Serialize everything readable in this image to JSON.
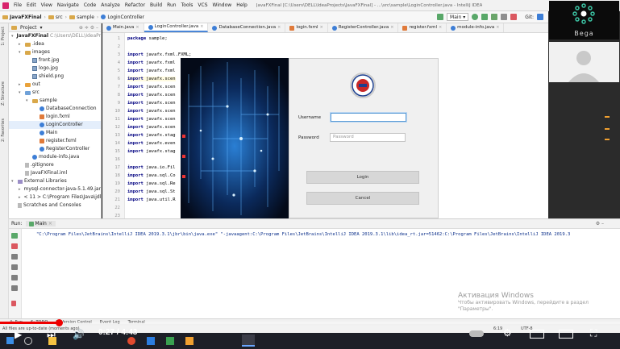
{
  "titlebar": {
    "menu": [
      "File",
      "Edit",
      "View",
      "Navigate",
      "Code",
      "Analyze",
      "Refactor",
      "Build",
      "Run",
      "Tools",
      "VCS",
      "Window",
      "Help"
    ],
    "title": "JavaFXFinal [C:\\Users\\DELL\\IdeaProjects\\JavaFXFinal] - ...\\src\\sample\\LoginController.java - IntelliJ IDEA"
  },
  "navbar": {
    "crumbs": [
      "JavaFXFinal",
      "src",
      "sample",
      "LoginController"
    ],
    "run_config": "Main",
    "git_label": "Git:"
  },
  "left_strip": {
    "top_label": "1: Project",
    "mid_label": "Z: Structure",
    "low_label": "2: Favorites"
  },
  "project": {
    "header": "Project",
    "tree": [
      {
        "label": "JavaFXFinal",
        "extra": "C:\\Users\\DELL\\IdeaProjects\\JavaFXFinal",
        "icon": "folder-blue",
        "depth": 0,
        "arrow": "▾"
      },
      {
        "label": ".idea",
        "icon": "folder",
        "depth": 1,
        "arrow": "▸"
      },
      {
        "label": "images",
        "icon": "folder",
        "depth": 1,
        "arrow": "▾"
      },
      {
        "label": "front.jpg",
        "icon": "image",
        "depth": 2,
        "arrow": ""
      },
      {
        "label": "logo.jpg",
        "icon": "image",
        "depth": 2,
        "arrow": ""
      },
      {
        "label": "shield.png",
        "icon": "image",
        "depth": 2,
        "arrow": ""
      },
      {
        "label": "out",
        "icon": "folder-orange",
        "depth": 1,
        "arrow": "▸"
      },
      {
        "label": "src",
        "icon": "folder-blue",
        "depth": 1,
        "arrow": "▾"
      },
      {
        "label": "sample",
        "icon": "folder",
        "depth": 2,
        "arrow": "▾"
      },
      {
        "label": "DatabaseConnection",
        "icon": "class",
        "depth": 3,
        "arrow": ""
      },
      {
        "label": "login.fxml",
        "icon": "fxml",
        "depth": 3,
        "arrow": ""
      },
      {
        "label": "LoginController",
        "icon": "class",
        "depth": 3,
        "arrow": ""
      },
      {
        "label": "Main",
        "icon": "class",
        "depth": 3,
        "arrow": ""
      },
      {
        "label": "register.fxml",
        "icon": "fxml",
        "depth": 3,
        "arrow": ""
      },
      {
        "label": "RegisterController",
        "icon": "class",
        "depth": 3,
        "arrow": ""
      },
      {
        "label": "module-info.java",
        "icon": "class",
        "depth": 2,
        "arrow": ""
      },
      {
        "label": ".gitignore",
        "icon": "file",
        "depth": 1,
        "arrow": ""
      },
      {
        "label": "JavaFXFinal.iml",
        "icon": "file",
        "depth": 1,
        "arrow": ""
      },
      {
        "label": "External Libraries",
        "icon": "lib",
        "depth": 0,
        "arrow": "▾"
      },
      {
        "label": "mysql-connector-java-5.1.49.jar",
        "icon": "lib",
        "depth": 1,
        "arrow": "▸"
      },
      {
        "label": "< 11 > C:\\Program Files\\Java\\jdk",
        "icon": "lib",
        "depth": 1,
        "arrow": "▸"
      },
      {
        "label": "Scratches and Consoles",
        "icon": "file",
        "depth": 0,
        "arrow": ""
      }
    ]
  },
  "editor": {
    "tabs": [
      {
        "label": "Main.java",
        "active": false
      },
      {
        "label": "LoginController.java",
        "active": true
      },
      {
        "label": "DatabaseConnection.java",
        "active": false
      },
      {
        "label": "login.fxml",
        "active": false
      },
      {
        "label": "RegisterController.java",
        "active": false
      },
      {
        "label": "register.fxml",
        "active": false
      },
      {
        "label": "module-info.java",
        "active": false
      }
    ],
    "line_numbers": [
      "1",
      "2",
      "3",
      "4",
      "5",
      "6",
      "7",
      "8",
      "9",
      "10",
      "11",
      "12",
      "13",
      "14",
      "15",
      "16",
      "17",
      "18",
      "19",
      "20",
      "21",
      "22",
      "23"
    ],
    "lines": [
      "package sample;",
      "",
      "import javafx.fxml.FXML;",
      "import javafx.fxml",
      "import javafx.fxml",
      "import javafx.scen",
      "import javafx.scen",
      "import javafx.scen",
      "import javafx.scen",
      "import javafx.scen",
      "import javafx.scen",
      "import javafx.scen",
      "import javafx.stag",
      "import javafx.even",
      "import javafx.stag",
      "",
      "import java.io.Fil",
      "import java.sql.Co",
      "import java.sql.Re",
      "import java.sql.St",
      "import java.util.R",
      "",
      ""
    ]
  },
  "app_window": {
    "username_label": "Username",
    "password_label": "Password",
    "username_value": "",
    "password_placeholder": "Password",
    "login_button": "Login",
    "cancel_button": "Cancel"
  },
  "webcam": {
    "name": "Bega"
  },
  "run_panel": {
    "run_label": "Run:",
    "config_tab": "Main",
    "console": "\"C:\\Program Files\\JetBrains\\IntelliJ IDEA 2019.3.1\\jbr\\bin\\java.exe\" \"-javaagent:C:\\Program Files\\JetBrains\\IntelliJ IDEA 2019.3.1\\lib\\idea_rt.jar=51462:C:\\Program Files\\JetBrains\\IntelliJ IDEA 2019.3"
  },
  "watermark": {
    "line1": "Активация Windows",
    "line2": "Чтобы активировать Windows, перейдите в раздел",
    "line3": "\"Параметры\"."
  },
  "bottom_tools": [
    "4: Run",
    "6: TODO",
    "9: Version Control",
    "Event Log",
    "Terminal"
  ],
  "status": {
    "message": "All files are up-to-date (moments ago)",
    "position": "6:19",
    "encoding": "UTF-8"
  },
  "video": {
    "time": "0:27 / 4:43",
    "progress": 0.0954
  },
  "colors": {
    "accent": "#4a86d8",
    "progress": "#ee0000"
  }
}
